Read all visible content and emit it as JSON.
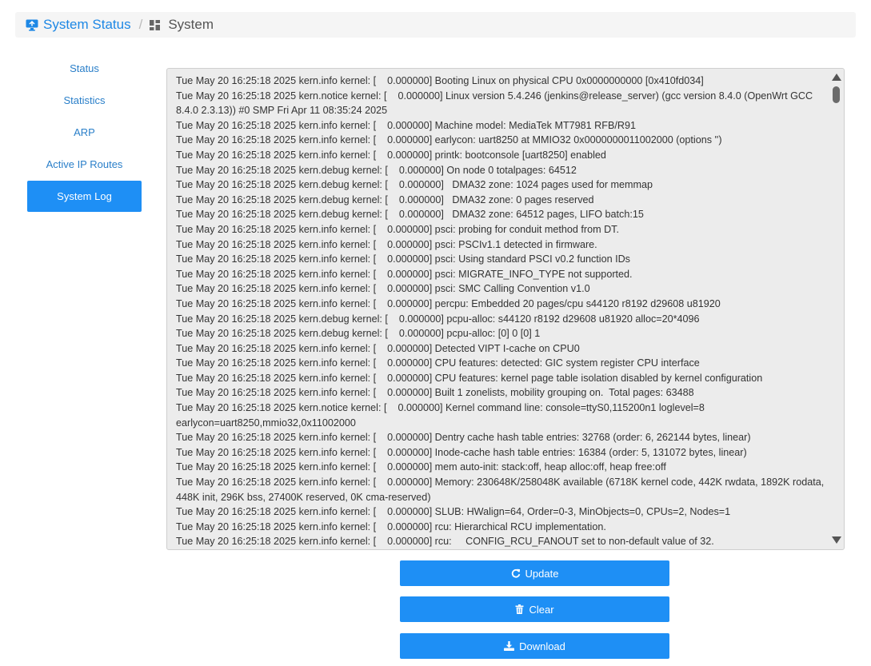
{
  "breadcrumb": {
    "home_icon": "monitor-icon",
    "home_label": "System Status",
    "separator": "/",
    "current_icon": "grid-icon",
    "current_label": "System"
  },
  "sidebar": {
    "items": [
      {
        "label": "Status"
      },
      {
        "label": "Statistics"
      },
      {
        "label": "ARP"
      },
      {
        "label": "Active IP Routes"
      },
      {
        "label": "System Log"
      }
    ],
    "active_index": 4
  },
  "log": {
    "lines": [
      "Tue May 20 16:25:18 2025 kern.info kernel: [    0.000000] Booting Linux on physical CPU 0x0000000000 [0x410fd034]",
      "Tue May 20 16:25:18 2025 kern.notice kernel: [    0.000000] Linux version 5.4.246 (jenkins@release_server) (gcc version 8.4.0 (OpenWrt GCC 8.4.0 2.3.13)) #0 SMP Fri Apr 11 08:35:24 2025",
      "Tue May 20 16:25:18 2025 kern.info kernel: [    0.000000] Machine model: MediaTek MT7981 RFB/R91",
      "Tue May 20 16:25:18 2025 kern.info kernel: [    0.000000] earlycon: uart8250 at MMIO32 0x0000000011002000 (options '')",
      "Tue May 20 16:25:18 2025 kern.info kernel: [    0.000000] printk: bootconsole [uart8250] enabled",
      "Tue May 20 16:25:18 2025 kern.debug kernel: [    0.000000] On node 0 totalpages: 64512",
      "Tue May 20 16:25:18 2025 kern.debug kernel: [    0.000000]   DMA32 zone: 1024 pages used for memmap",
      "Tue May 20 16:25:18 2025 kern.debug kernel: [    0.000000]   DMA32 zone: 0 pages reserved",
      "Tue May 20 16:25:18 2025 kern.debug kernel: [    0.000000]   DMA32 zone: 64512 pages, LIFO batch:15",
      "Tue May 20 16:25:18 2025 kern.info kernel: [    0.000000] psci: probing for conduit method from DT.",
      "Tue May 20 16:25:18 2025 kern.info kernel: [    0.000000] psci: PSCIv1.1 detected in firmware.",
      "Tue May 20 16:25:18 2025 kern.info kernel: [    0.000000] psci: Using standard PSCI v0.2 function IDs",
      "Tue May 20 16:25:18 2025 kern.info kernel: [    0.000000] psci: MIGRATE_INFO_TYPE not supported.",
      "Tue May 20 16:25:18 2025 kern.info kernel: [    0.000000] psci: SMC Calling Convention v1.0",
      "Tue May 20 16:25:18 2025 kern.info kernel: [    0.000000] percpu: Embedded 20 pages/cpu s44120 r8192 d29608 u81920",
      "Tue May 20 16:25:18 2025 kern.debug kernel: [    0.000000] pcpu-alloc: s44120 r8192 d29608 u81920 alloc=20*4096",
      "Tue May 20 16:25:18 2025 kern.debug kernel: [    0.000000] pcpu-alloc: [0] 0 [0] 1",
      "Tue May 20 16:25:18 2025 kern.info kernel: [    0.000000] Detected VIPT I-cache on CPU0",
      "Tue May 20 16:25:18 2025 kern.info kernel: [    0.000000] CPU features: detected: GIC system register CPU interface",
      "Tue May 20 16:25:18 2025 kern.info kernel: [    0.000000] CPU features: kernel page table isolation disabled by kernel configuration",
      "Tue May 20 16:25:18 2025 kern.info kernel: [    0.000000] Built 1 zonelists, mobility grouping on.  Total pages: 63488",
      "Tue May 20 16:25:18 2025 kern.notice kernel: [    0.000000] Kernel command line: console=ttyS0,115200n1 loglevel=8 earlycon=uart8250,mmio32,0x11002000",
      "Tue May 20 16:25:18 2025 kern.info kernel: [    0.000000] Dentry cache hash table entries: 32768 (order: 6, 262144 bytes, linear)",
      "Tue May 20 16:25:18 2025 kern.info kernel: [    0.000000] Inode-cache hash table entries: 16384 (order: 5, 131072 bytes, linear)",
      "Tue May 20 16:25:18 2025 kern.info kernel: [    0.000000] mem auto-init: stack:off, heap alloc:off, heap free:off",
      "Tue May 20 16:25:18 2025 kern.info kernel: [    0.000000] Memory: 230648K/258048K available (6718K kernel code, 442K rwdata, 1892K rodata, 448K init, 296K bss, 27400K reserved, 0K cma-reserved)",
      "Tue May 20 16:25:18 2025 kern.info kernel: [    0.000000] SLUB: HWalign=64, Order=0-3, MinObjects=0, CPUs=2, Nodes=1",
      "Tue May 20 16:25:18 2025 kern.info kernel: [    0.000000] rcu: Hierarchical RCU implementation.",
      "Tue May 20 16:25:18 2025 kern.info kernel: [    0.000000] rcu:     CONFIG_RCU_FANOUT set to non-default value of 32."
    ]
  },
  "buttons": {
    "update": {
      "label": "Update",
      "icon": "refresh-icon"
    },
    "clear": {
      "label": "Clear",
      "icon": "trash-icon"
    },
    "download": {
      "label": "Download",
      "icon": "download-icon"
    }
  }
}
